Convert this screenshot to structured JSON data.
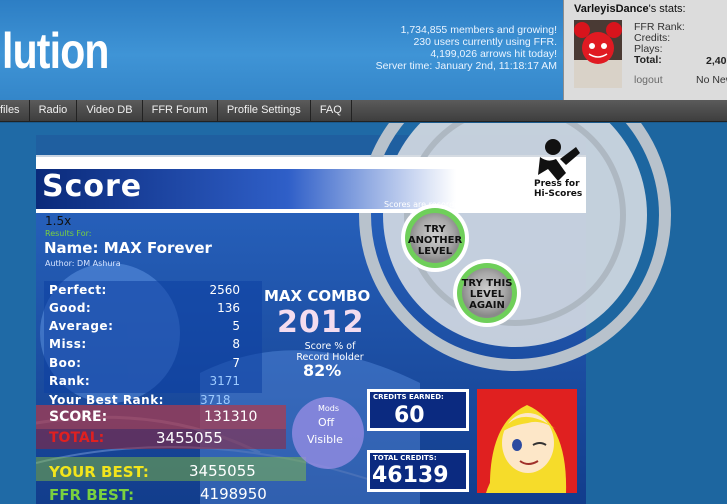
{
  "header": {
    "logo_text": "lution",
    "stats": [
      "1,734,855 members and growing!",
      "230 users currently using FFR.",
      "4,199,026 arrows hit today!",
      "Server time: January 2nd, 11:18:17 AM"
    ]
  },
  "user_panel": {
    "username": "VarleyisDance",
    "title_suffix": "'s stats:",
    "fields": [
      "FFR Rank:",
      "Credits:",
      "Plays:"
    ],
    "total_label": "Total:",
    "total_value": "2,40",
    "logout": "logout",
    "news": "No New"
  },
  "nav": [
    "files",
    "Radio",
    "Video DB",
    "FFR Forum",
    "Profile Settings",
    "FAQ"
  ],
  "game": {
    "score_title": "Score",
    "press_for": "Press for",
    "hi_scores": "Hi-Scores",
    "scores_note": "Scores are recorded and compared",
    "speed": "1.5x",
    "results_for": "Results For:",
    "song_name": "Name: MAX Forever",
    "song_author": "Author: DM Ashura",
    "try_another": [
      "TRY",
      "ANOTHER",
      "LEVEL"
    ],
    "try_this": [
      "TRY THIS",
      "LEVEL",
      "AGAIN"
    ],
    "stats": [
      {
        "label": "Perfect:",
        "value": "2560"
      },
      {
        "label": "Good:",
        "value": "136"
      },
      {
        "label": "Average:",
        "value": "5"
      },
      {
        "label": "Miss:",
        "value": "8"
      },
      {
        "label": "Boo:",
        "value": "7"
      },
      {
        "label": "Rank:",
        "value": "3171"
      }
    ],
    "max_combo_label": "MAX COMBO",
    "max_combo_value": "2012",
    "score_pct_label": [
      "Score % of",
      "Record Holder"
    ],
    "score_pct_value": "82%",
    "your_best_rank_label": "Your Best Rank:",
    "your_best_rank_value": "3718",
    "score_label": "SCORE:",
    "score_value": "131310",
    "total_label": "TOTAL:",
    "total_value": "3455055",
    "your_best_label": "YOUR BEST:",
    "your_best_value": "3455055",
    "ffr_best_label": "FFR BEST:",
    "ffr_best_value": "4198950",
    "mods_label": "Mods",
    "mods_off": "Off",
    "mods_visible": "Visible",
    "credits_earned_label": "CREDITS EARNED:",
    "credits_earned_value": "60",
    "total_credits_label": "TOTAL CREDITS:",
    "total_credits_value": "46139",
    "colors": {
      "panel_dark": "#0a2a6e",
      "green": "#7ad13f",
      "red": "#e02020",
      "yellow": "#f2e51c"
    }
  }
}
